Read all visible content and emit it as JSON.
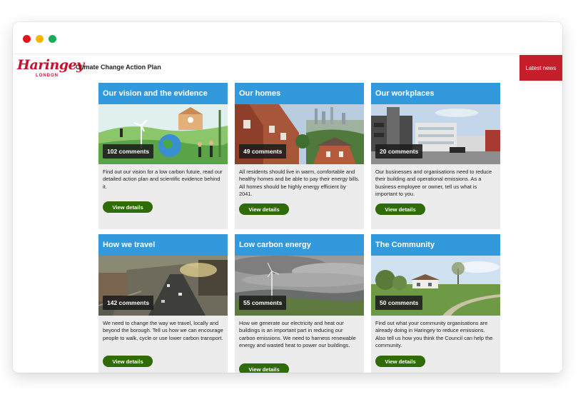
{
  "header": {
    "logo_text": "Haringey",
    "logo_sub": "LONDON",
    "site_title": "Climate Change Action Plan",
    "latest_news_label": "Latest news"
  },
  "cards": [
    {
      "title": "Our vision and the evidence",
      "comments": "102 comments",
      "text": "Find out our vision for a low carbon future, read our detailed action plan and scientific evidence behind it.",
      "button": "View details"
    },
    {
      "title": "Our homes",
      "comments": "49 comments",
      "text": "All residents should live in warm, comfortable and healthy homes and be able to pay their energy bills. All homes should be highly energy efficient by 2041.",
      "button": "View details"
    },
    {
      "title": "Our workplaces",
      "comments": "20 comments",
      "text": "Our businesses and organisations need to reduce their building and operational emissions. As a business employee or owner, tell us what is important to you.",
      "button": "View details"
    },
    {
      "title": "How we travel",
      "comments": "142 comments",
      "text": "We need to change the way we travel, locally and beyond the borough. Tell us how we can encourage people to walk, cycle or use lower carbon transport.",
      "button": "View details"
    },
    {
      "title": "Low carbon energy",
      "comments": "55 comments",
      "text": "How we generate our electricity and heat our buildings is an important part in reducing our carbon emissions. We need to harness renewable energy and wasted heat to power our buildings.",
      "button": "View details"
    },
    {
      "title": "The Community",
      "comments": "50 comments",
      "text": "Find out what your community organisations are already doing in Haringey to reduce emissions. Also tell us how you think the Council can help the community.",
      "button": "View details"
    }
  ],
  "colors": {
    "brand_red": "#c8102e",
    "card_header_blue": "#3399dd",
    "button_green": "#2f6b06",
    "latest_news_bg": "#c41e2a"
  }
}
